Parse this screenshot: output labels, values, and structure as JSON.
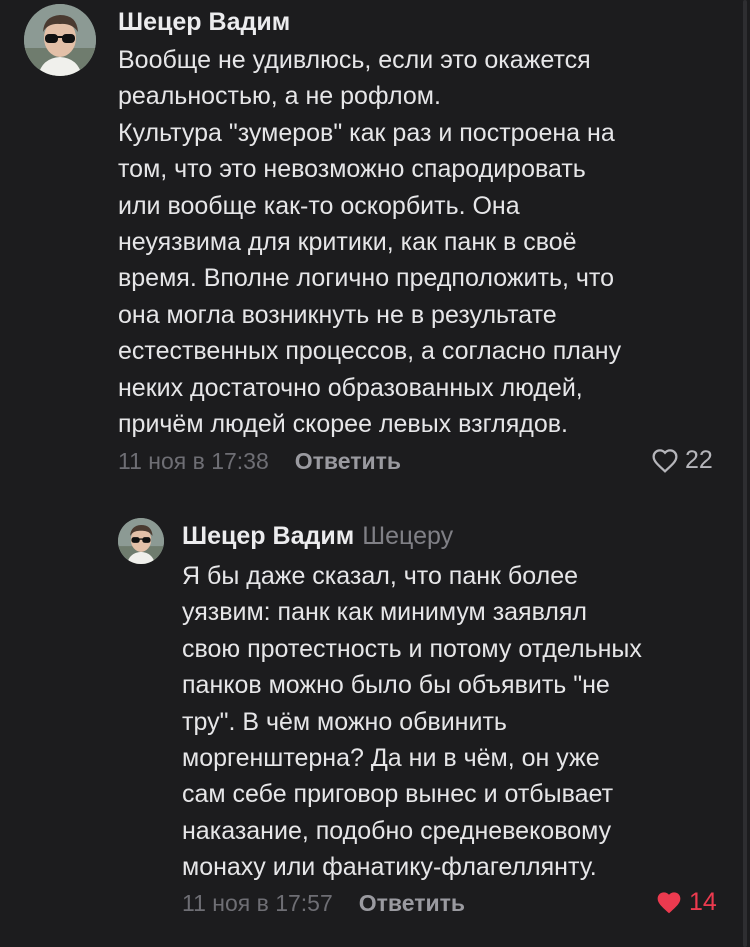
{
  "comments": [
    {
      "author": "Шецер Вадим",
      "text": "Вообще не удивлюсь, если это окажется\nреальностью, а не рофлом.\nКультура \"зумеров\" как раз и построена на\nтом, что это невозможно спародировать\nили вообще как-то оскорбить. Она\nнеуязвима для критики, как панк в своё\nвремя. Вполне логично предположить, что\nона могла возникнуть не в результате\nестественных процессов, а согласно плану\nнеких достаточно образованных людей,\nпричём людей скорее левых взглядов.",
      "time": "11 ноя в 17:38",
      "reply_label": "Ответить",
      "likes": "22",
      "liked": false,
      "like_icon": "heart-outline-icon"
    },
    {
      "author": "Шецер Вадим",
      "reply_to": "Шецеру",
      "text": "Я бы даже сказал, что панк более\nуязвим: панк как минимум заявлял\nсвою протестность и потому отдельных\nпанков можно было бы объявить \"не\nтру\". В чём можно обвинить\nморгенштерна? Да ни в чём, он уже\nсам себе приговор вынес и отбывает\nнаказание, подобно средневековому\nмонаху или фанатику-флагеллянту.",
      "time": "11 ноя в 17:57",
      "reply_label": "Ответить",
      "likes": "14",
      "liked": true,
      "like_icon": "heart-filled-icon"
    }
  ],
  "colors": {
    "background": "#1c1c1e",
    "liked": "#ec3a4f",
    "like_count_default": "#b6b6bb",
    "secondary_text": "#6e6e74"
  }
}
